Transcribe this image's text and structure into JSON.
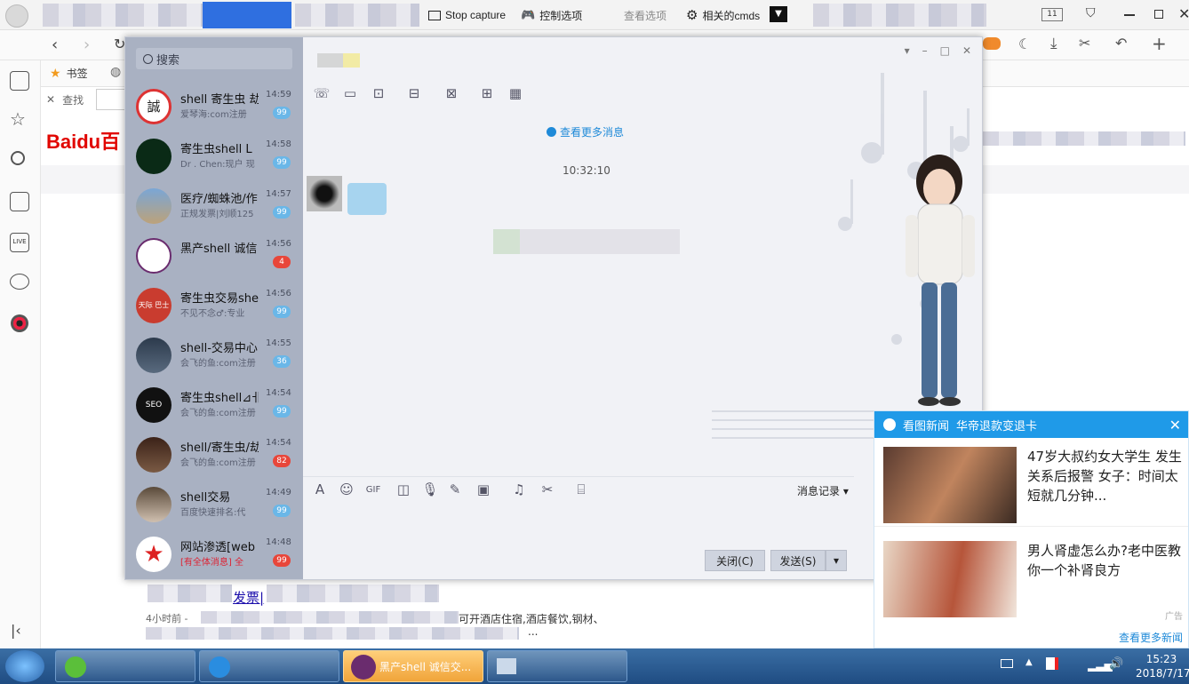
{
  "browser": {
    "toolbar": {
      "stop_capture": "Stop capture",
      "control_options": "控制选项",
      "view_options": "查看选项",
      "related_cmds": "相关的cmds",
      "tab_count": "11"
    },
    "bookmarks_label": "书签",
    "find_label": "查找",
    "baidu_logo": "Baidu百"
  },
  "chat": {
    "search_placeholder": "搜索",
    "view_more": "查看更多消息",
    "timestamp": "10:32:10",
    "message_history": "消息记录",
    "close_button": "关闭(C)",
    "send_button": "发送(S)",
    "contacts": [
      {
        "name": "shell 寄生虫 劫",
        "time": "14:59",
        "preview": "爱琴海:com注册",
        "badge": "99",
        "avatar_text": "誠"
      },
      {
        "name": "寄生虫shell L",
        "time": "14:58",
        "preview": "Dr . Chen:现户 现",
        "badge": "99",
        "avatar_text": ""
      },
      {
        "name": "医疗/蜘蛛池/作",
        "time": "14:57",
        "preview": "正规发票|刘顺125",
        "badge": "99",
        "avatar_text": ""
      },
      {
        "name": "黑产shell 诚信",
        "time": "14:56",
        "preview": "",
        "badge": "4",
        "avatar_text": ""
      },
      {
        "name": "寄生虫交易she",
        "time": "14:56",
        "preview": "不见不念♂:专业",
        "badge": "99",
        "avatar_text": "天际 巴士"
      },
      {
        "name": "shell-交易中心",
        "time": "14:55",
        "preview": "会飞的鱼:com注册",
        "badge": "36",
        "avatar_text": ""
      },
      {
        "name": "寄生虫shell⊿卝",
        "time": "14:54",
        "preview": "会飞的鱼:com注册",
        "badge": "99",
        "avatar_text": "SEO"
      },
      {
        "name": "shell/寄生虫/劫",
        "time": "14:54",
        "preview": "会飞的鱼:com注册",
        "badge": "82",
        "avatar_text": ""
      },
      {
        "name": "shell交易",
        "time": "14:49",
        "preview": "百度快速排名:代",
        "badge": "99",
        "avatar_text": ""
      },
      {
        "name": "网站渗透[web",
        "time": "14:48",
        "preview": "[有全体消息] 全",
        "badge": "99",
        "avatar_text": ""
      }
    ]
  },
  "news_popup": {
    "header": "看图新闻",
    "subheader": "华帝退款变退卡",
    "items": [
      {
        "headline": "47岁大叔约女大学生 发生关系后报警 女子：时间太短就几分钟..."
      },
      {
        "headline": "男人肾虚怎么办?老中医教你一个补肾良方"
      }
    ],
    "ad_label": "广告",
    "more_link": "查看更多新闻"
  },
  "page_snippets": {
    "invoice_link": "发票|",
    "hotel_text": "可开酒店住宿,酒店餐饮,钢材、",
    "date_prefix": "4小时前 -",
    "ellipsis": "..."
  },
  "taskbar": {
    "active_task": "黑产shell 诚信交...",
    "time": "15:23",
    "date": "2018/7/17"
  },
  "colors": {
    "accent_blue": "#1f9ae8",
    "badge_blue": "#6ab7e8",
    "badge_red": "#e8463a",
    "contacts_bg": "#a9b1c2"
  }
}
